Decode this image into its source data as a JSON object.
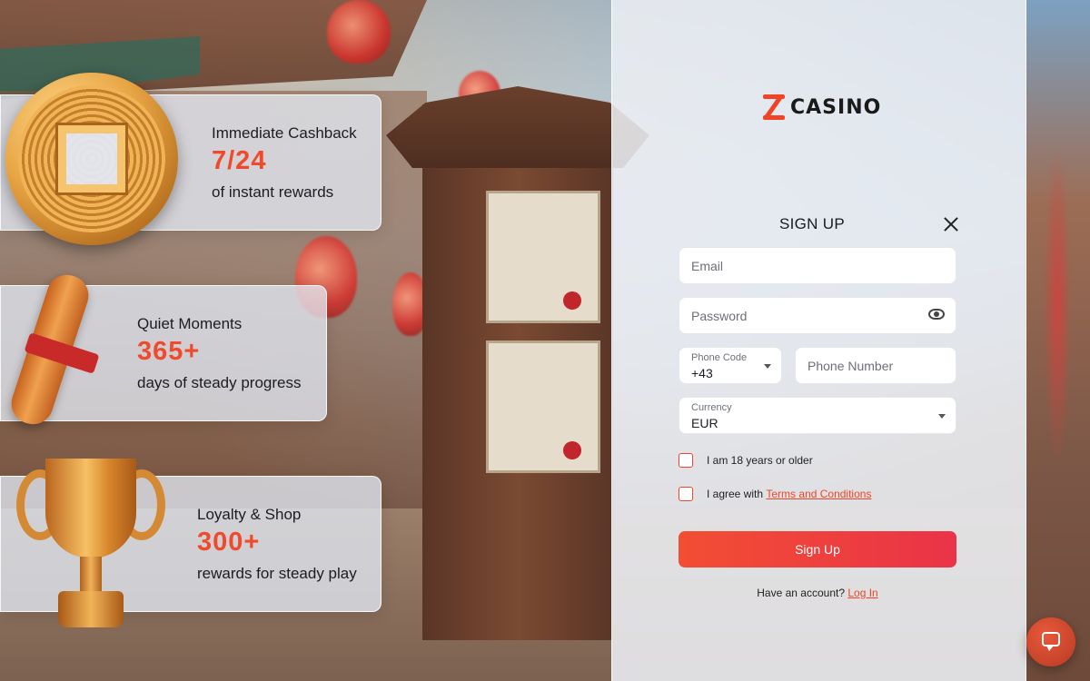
{
  "brand": {
    "name": "CASINO",
    "accent": "#ef4526"
  },
  "promos": [
    {
      "icon": "gold-coin-icon",
      "title": "Immediate Cashback",
      "value": "7/24",
      "description": "of instant rewards"
    },
    {
      "icon": "scroll-icon",
      "title": "Quiet Moments",
      "value": "365+",
      "description": "days of steady progress"
    },
    {
      "icon": "trophy-icon",
      "title": "Loyalty & Shop",
      "value": "300+",
      "description": "rewards for steady play"
    }
  ],
  "signup": {
    "title": "SIGN UP",
    "email_placeholder": "Email",
    "password_placeholder": "Password",
    "phone_code_label": "Phone Code",
    "phone_code_value": "+43",
    "phone_number_placeholder": "Phone Number",
    "currency_label": "Currency",
    "currency_value": "EUR",
    "age_label": "I am 18 years or older",
    "terms_prefix": "I agree with",
    "terms_link": "Terms and Conditions",
    "submit_label": "Sign Up",
    "have_account": "Have an account?",
    "login_link": "Log In"
  }
}
